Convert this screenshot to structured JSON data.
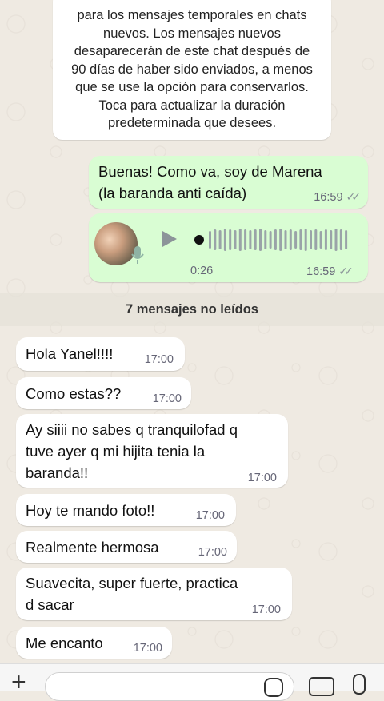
{
  "system_notice": {
    "lines": [
      "para los mensajes temporales en chats",
      "nuevos. Los mensajes nuevos",
      "desaparecerán de este chat después de",
      "90 días de haber sido enviados, a menos",
      "que se use la opción para conservarlos.",
      "Toca para actualizar la duración",
      "predeterminada que desees."
    ]
  },
  "outgoing": {
    "text_lines": [
      "Buenas! Como va, soy de Marena",
      "(la baranda anti caída)"
    ],
    "text_time": "16:59",
    "voice_duration": "0:26",
    "voice_time": "16:59",
    "ticks": "✓✓"
  },
  "unread_banner": "7 mensajes no leídos",
  "incoming": [
    {
      "lines": [
        "Hola Yanel!!!!"
      ],
      "time": "17:00"
    },
    {
      "lines": [
        "Como estas??"
      ],
      "time": "17:00"
    },
    {
      "lines": [
        "Ay siiii no sabes q tranquilofad q",
        "tuve ayer q mi hijita tenia la",
        "baranda!!"
      ],
      "time": "17:00"
    },
    {
      "lines": [
        "Hoy te mando foto!!"
      ],
      "time": "17:00"
    },
    {
      "lines": [
        "Realmente hermosa"
      ],
      "time": "17:00"
    },
    {
      "lines": [
        "Suavecita, super fuerte, practica",
        "d sacar"
      ],
      "time": "17:00"
    },
    {
      "lines": [
        "Me encanto"
      ],
      "time": "17:00"
    }
  ],
  "composer": {
    "plus_symbol": "+",
    "icons": [
      "plus-icon",
      "sticker-icon",
      "camera-icon",
      "microphone-icon"
    ]
  },
  "colors": {
    "outgoing_bubble": "#d9fdd3",
    "incoming_bubble": "#ffffff",
    "wallpaper": "#efeae2"
  }
}
